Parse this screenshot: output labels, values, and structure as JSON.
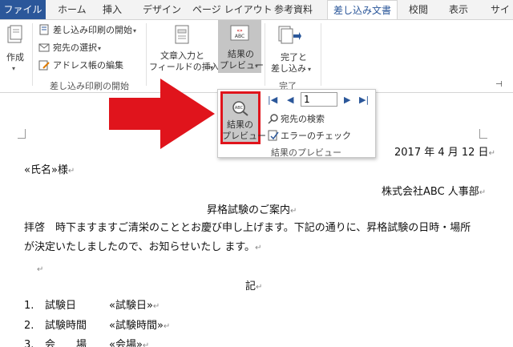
{
  "tabs": [
    {
      "label": "ファイル"
    },
    {
      "label": "ホーム"
    },
    {
      "label": "挿入"
    },
    {
      "label": "デザイン"
    },
    {
      "label": "ページ レイアウト"
    },
    {
      "label": "参考資料"
    },
    {
      "label": "差し込み文書"
    },
    {
      "label": "校閲"
    },
    {
      "label": "表示"
    },
    {
      "label": "サイ"
    }
  ],
  "ribbon": {
    "create": {
      "label": "作成"
    },
    "start_group": {
      "start_merge": "差し込み印刷の開始",
      "select_recipients": "宛先の選択",
      "edit_list": "アドレス帳の編集",
      "group_label": "差し込み印刷の開始"
    },
    "write_insert": {
      "line1": "文章入力と",
      "line2": "フィールドの挿入"
    },
    "preview": {
      "line1": "結果の",
      "line2": "プレビュー"
    },
    "finish": {
      "line1": "完了と",
      "line2": "差し込み",
      "group_label": "完了"
    }
  },
  "popup": {
    "preview_button": {
      "line1": "結果の",
      "line2": "プレビュー"
    },
    "record_value": "1",
    "find_recipient": "宛先の検索",
    "check_errors": "エラーのチェック",
    "group_label": "結果のプレビュー"
  },
  "document": {
    "date": "2017 年 4 月 12 日",
    "addressee": "«氏名»様",
    "sender": "株式会社ABC 人事部",
    "title": "昇格試験のご案内",
    "body_line1": "拝啓　時下ますますご清栄のこととお慶び申し上げます。下記の通りに、昇格試験の日時・場所",
    "body_line2": "が決定いたしましたので、お知らせいたし ます。",
    "ki": "記",
    "items": [
      {
        "num": "1.",
        "label": "試験日",
        "field": "«試験日»"
      },
      {
        "num": "2.",
        "label": "試験時間",
        "field": "«試験時間»"
      },
      {
        "num": "3.",
        "label": "会　　場",
        "field": "«会場»"
      }
    ]
  },
  "colors": {
    "accent": "#2b579a",
    "highlight": "#e0141c",
    "pressed": "#c5c5c5"
  }
}
